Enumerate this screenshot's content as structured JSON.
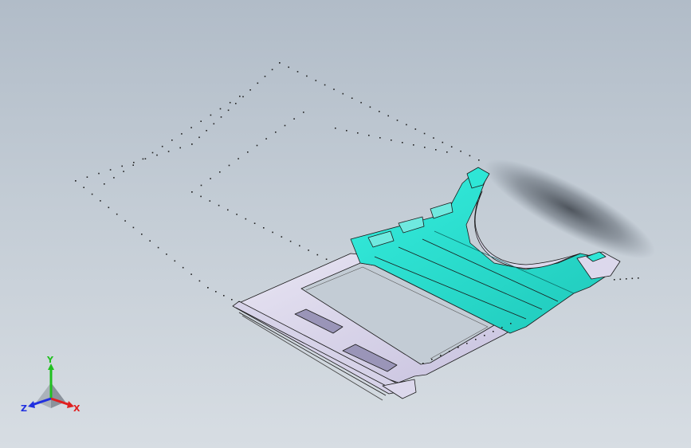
{
  "viewport": {
    "background_top": "#b1bcc8",
    "background_bottom": "#d7dde3"
  },
  "model": {
    "colors": {
      "selected_face": "#2ee6d6",
      "selected_face_shade": "#22c9bb",
      "part_face": "#dcd8ec",
      "part_face_shade": "#c9c4df",
      "edge": "#1a1a1a",
      "sketch_point": "#222222"
    }
  },
  "triad": {
    "x_label": "X",
    "y_label": "Y",
    "z_label": "Z",
    "x_color": "#e02020",
    "y_color": "#20c020",
    "z_color": "#2030e0"
  }
}
